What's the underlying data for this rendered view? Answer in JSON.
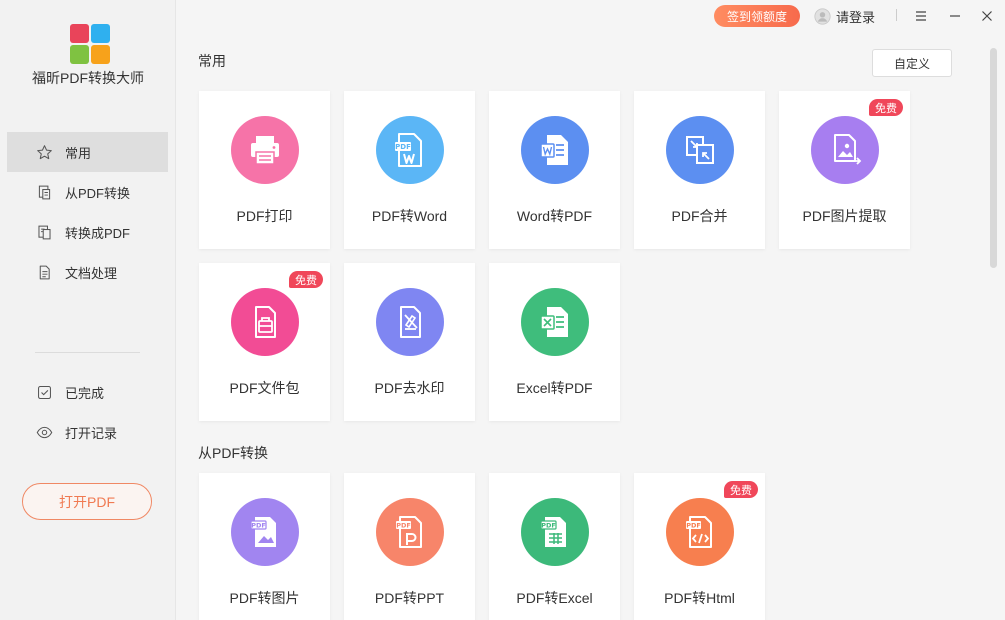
{
  "app": {
    "name": "福昕PDF转换大师",
    "logo_colors": [
      "#e9445a",
      "#2fb0ef",
      "#7fc241",
      "#f7a21b"
    ]
  },
  "sidebar": {
    "nav_top": [
      {
        "label": "常用",
        "icon": "star-icon",
        "active": true
      },
      {
        "label": "从PDF转换",
        "icon": "from-pdf-icon",
        "active": false
      },
      {
        "label": "转换成PDF",
        "icon": "to-pdf-icon",
        "active": false
      },
      {
        "label": "文档处理",
        "icon": "document-icon",
        "active": false
      }
    ],
    "nav_bottom": [
      {
        "label": "已完成",
        "icon": "check-icon"
      },
      {
        "label": "打开记录",
        "icon": "eye-icon"
      }
    ],
    "open_button": "打开PDF"
  },
  "topbar": {
    "sign_button": "签到领额度",
    "login_label": "请登录"
  },
  "sections": [
    {
      "title": "常用",
      "custom_button": "自定义",
      "cards": [
        {
          "label": "PDF打印",
          "color": "#f673a8",
          "icon": "printer-icon",
          "badge": ""
        },
        {
          "label": "PDF转Word",
          "color": "#5bb6f6",
          "icon": "pdf-to-word-icon",
          "badge": ""
        },
        {
          "label": "Word转PDF",
          "color": "#5c8ff1",
          "icon": "word-to-pdf-icon",
          "badge": ""
        },
        {
          "label": "PDF合并",
          "color": "#5c8ff1",
          "icon": "merge-icon",
          "badge": ""
        },
        {
          "label": "PDF图片提取",
          "color": "#a77ef0",
          "icon": "image-extract-icon",
          "badge": "免费"
        },
        {
          "label": "PDF文件包",
          "color": "#f24c95",
          "icon": "file-package-icon",
          "badge": "免费"
        },
        {
          "label": "PDF去水印",
          "color": "#7f86f2",
          "icon": "remove-watermark-icon",
          "badge": ""
        },
        {
          "label": "Excel转PDF",
          "color": "#3fbd7c",
          "icon": "excel-to-pdf-icon",
          "badge": ""
        }
      ]
    },
    {
      "title": "从PDF转换",
      "cards": [
        {
          "label": "PDF转图片",
          "color": "#a185f0",
          "icon": "pdf-to-image-icon",
          "badge": ""
        },
        {
          "label": "PDF转PPT",
          "color": "#f7856a",
          "icon": "pdf-to-ppt-icon",
          "badge": ""
        },
        {
          "label": "PDF转Excel",
          "color": "#3cb97a",
          "icon": "pdf-to-excel-icon",
          "badge": ""
        },
        {
          "label": "PDF转Html",
          "color": "#f77f4f",
          "icon": "pdf-to-html-icon",
          "badge": "免费"
        }
      ]
    }
  ]
}
